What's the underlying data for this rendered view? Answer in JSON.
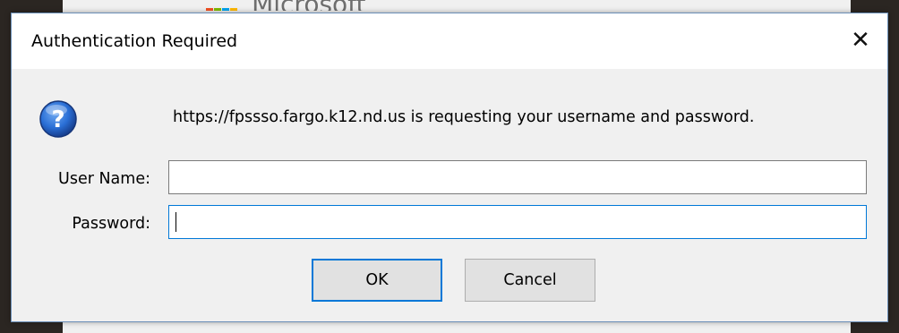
{
  "background": {
    "logo_text": "Microsoft",
    "logo_colors": [
      "#f25022",
      "#7fba00",
      "#00a4ef",
      "#ffb900"
    ]
  },
  "dialog": {
    "title": "Authentication Required",
    "close_label": "✕",
    "message": "https://fpssso.fargo.k12.nd.us is requesting your username and password.",
    "icon": "question-icon",
    "username_label": "User Name:",
    "username_value": "",
    "password_label": "Password:",
    "password_value": "",
    "ok_label": "OK",
    "cancel_label": "Cancel"
  },
  "colors": {
    "focus_border": "#0078d7",
    "icon_blue": "#1f5fbf"
  }
}
